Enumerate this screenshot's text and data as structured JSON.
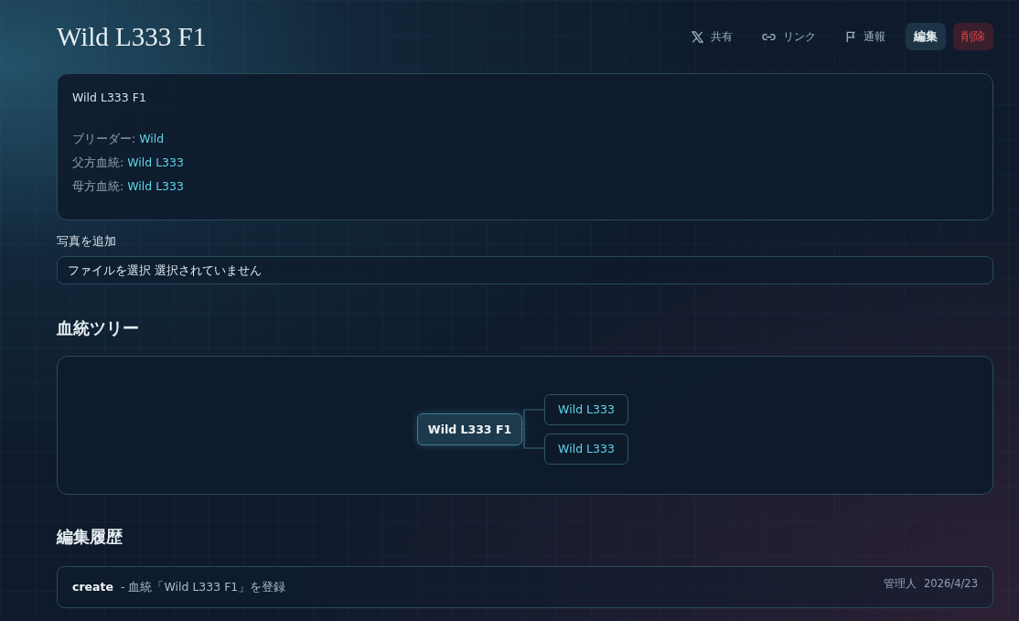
{
  "title": "Wild L333 F1",
  "actions": [
    {
      "kind": "share",
      "label": "共有"
    },
    {
      "kind": "link",
      "label": "リンク"
    },
    {
      "kind": "report",
      "label": "通報"
    }
  ],
  "edit_button": "編集",
  "delete_button": "削除",
  "info": {
    "name": "Wild L333 F1",
    "fields": [
      {
        "label": "ブリーダー:",
        "value": "Wild"
      },
      {
        "label": "父方血統:",
        "value": "Wild L333"
      },
      {
        "label": "母方血統:",
        "value": "Wild L333"
      }
    ]
  },
  "photo": {
    "label": "写真を追加",
    "file_button": "ファイルを選択",
    "file_status": "選択されていません"
  },
  "tree": {
    "heading": "血統ツリー",
    "root": "Wild L333 F1",
    "parents": [
      "Wild L333",
      "Wild L333"
    ]
  },
  "history": {
    "heading": "編集履歴",
    "entries": [
      {
        "action": "create",
        "description": "- 血統「Wild L333 F1」を登録",
        "user": "管理人",
        "date": "2026/4/23"
      }
    ]
  }
}
